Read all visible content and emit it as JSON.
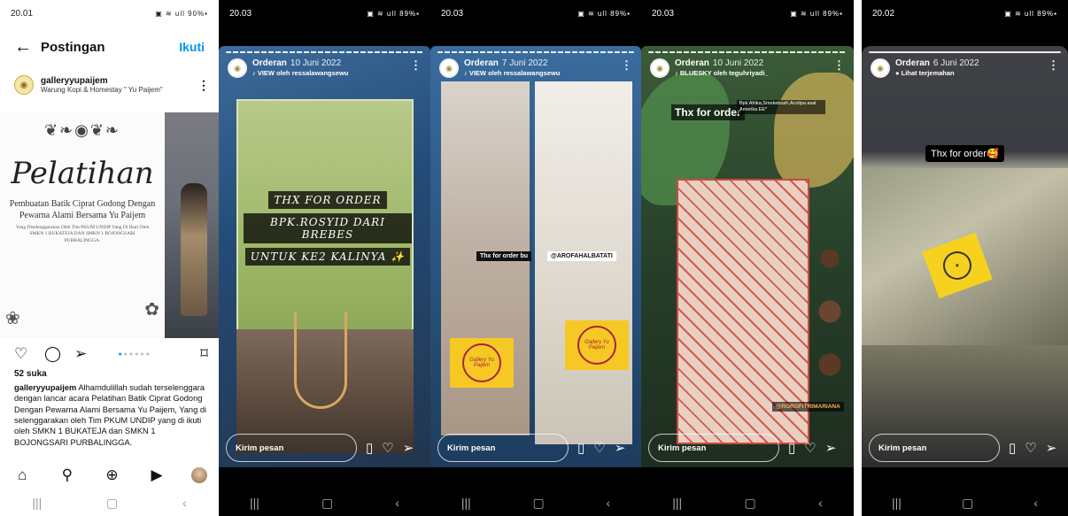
{
  "post": {
    "status": {
      "time": "20.01",
      "icons": "▣ ⊙ ⊙ •",
      "right": "▣ ≋ ull 90%▪"
    },
    "header": {
      "title": "Postingan",
      "follow_label": "Ikuti"
    },
    "account": {
      "username": "galleryyupaijem",
      "subtitle": "Warung Kopi & Homestay \" Yu Paijem\""
    },
    "image": {
      "title_script": "Pelatihan",
      "subtitle": "Pembuatan Batik Ciprat Godong Dengan Pewarna Alami Bersama Yu Paijem",
      "small_text": "Yang Diselenggarakan Oleh Tim PKUM UNDIP Yang Di Ikuti Oleh SMKN 1 BUKATEJA DAN SMKN 1 BOJONGSARI PURBALINGGA."
    },
    "likes": "52 suka",
    "caption_user": "galleryyupaijem",
    "caption_text": "Alhamdulillah sudah terselenggara dengan lancar acara Pelatihan Batik Ciprat Godong Dengan Pewarna Alami Bersama Yu Paijem, Yang di selenggarakan oleh Tim PKUM UNDIP yang di ikuti oleh SMKN 1 BUKATEJA dan SMKN 1 BOJONGSARI PURBALINGGA."
  },
  "stories": [
    {
      "time": "20.03",
      "right": "▣ ≋ ull 89%▪",
      "account": "Orderan",
      "date": "10 Juni 2022",
      "sub": "♪ VIEW oleh ressalawangsewu",
      "overlay_lines": [
        "THX FOR ORDER",
        "BPK.ROSYID DARI BREBES",
        "UNTUK KE2 KALINYA ✨"
      ],
      "reply_placeholder": "Kirim pesan"
    },
    {
      "time": "20.03",
      "right": "▣ ≋ ull 89%▪",
      "account": "Orderan",
      "date": "7 Juni 2022",
      "sub": "♪ VIEW oleh ressalawangsewu",
      "tag_text": "Thx for order bu",
      "mention": "@AROFAHALBATATI",
      "sticker_text": "Gallery Yu Paijem",
      "reply_placeholder": "Kirim pesan"
    },
    {
      "time": "20.03",
      "right": "▣ ≋ ull 89%▪",
      "account": "Orderan",
      "date": "10 Juni 2022",
      "sub": "♪ BLUESKY oleh teguhriyadi_",
      "thx": "Thx for order",
      "thx_sub": "Bpk Afrika,Smokebush,Acolipa asal Amerika EE*",
      "mention": "@ROROFITRIMARIANA",
      "reply_placeholder": "Kirim pesan"
    },
    {
      "time": "20.02",
      "right": "▣ ≋ ull 89%▪",
      "account": "Orderan",
      "date": "6 Juni 2022",
      "sub": "● Lihat terjemahan",
      "thx": "Thx for order🥰",
      "reply_placeholder": "Kirim pesan"
    }
  ],
  "colors": {
    "accent": "#0095f6",
    "sticker_yellow": "#f6c824"
  }
}
